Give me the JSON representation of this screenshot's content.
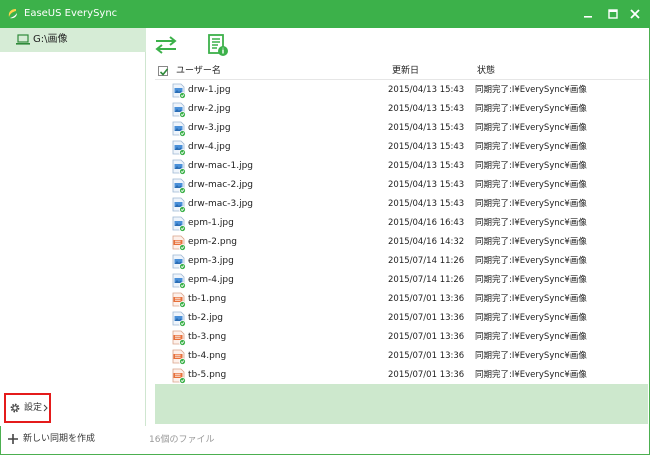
{
  "app": {
    "title": "EaseUS EverySync"
  },
  "sidebar": {
    "active_item": "G:\\画像",
    "settings_label": "設定",
    "new_sync_label": "新しい同期を作成"
  },
  "icons": {
    "logo": "easeus-logo-icon",
    "sync": "sync-arrows-icon",
    "report": "report-info-icon"
  },
  "colors": {
    "accent": "#3cb14a",
    "sidebar_active": "#d6ecd6",
    "highlight_box": "#e41b1b"
  },
  "table": {
    "headers": {
      "name": "ユーザー名",
      "date": "更新日",
      "status": "状態"
    },
    "rows": [
      {
        "name": "drw-1.jpg",
        "date": "2015/04/13 15:43",
        "status": "同期完了:I¥EverySync¥画像",
        "type": "jpg"
      },
      {
        "name": "drw-2.jpg",
        "date": "2015/04/13 15:43",
        "status": "同期完了:I¥EverySync¥画像",
        "type": "jpg"
      },
      {
        "name": "drw-3.jpg",
        "date": "2015/04/13 15:43",
        "status": "同期完了:I¥EverySync¥画像",
        "type": "jpg"
      },
      {
        "name": "drw-4.jpg",
        "date": "2015/04/13 15:43",
        "status": "同期完了:I¥EverySync¥画像",
        "type": "jpg"
      },
      {
        "name": "drw-mac-1.jpg",
        "date": "2015/04/13 15:43",
        "status": "同期完了:I¥EverySync¥画像",
        "type": "jpg"
      },
      {
        "name": "drw-mac-2.jpg",
        "date": "2015/04/13 15:43",
        "status": "同期完了:I¥EverySync¥画像",
        "type": "jpg"
      },
      {
        "name": "drw-mac-3.jpg",
        "date": "2015/04/13 15:43",
        "status": "同期完了:I¥EverySync¥画像",
        "type": "jpg"
      },
      {
        "name": "epm-1.jpg",
        "date": "2015/04/16 16:43",
        "status": "同期完了:I¥EverySync¥画像",
        "type": "jpg"
      },
      {
        "name": "epm-2.png",
        "date": "2015/04/16 14:32",
        "status": "同期完了:I¥EverySync¥画像",
        "type": "png"
      },
      {
        "name": "epm-3.jpg",
        "date": "2015/07/14 11:26",
        "status": "同期完了:I¥EverySync¥画像",
        "type": "jpg"
      },
      {
        "name": "epm-4.jpg",
        "date": "2015/07/14 11:26",
        "status": "同期完了:I¥EverySync¥画像",
        "type": "jpg"
      },
      {
        "name": "tb-1.png",
        "date": "2015/07/01 13:36",
        "status": "同期完了:I¥EverySync¥画像",
        "type": "png"
      },
      {
        "name": "tb-2.jpg",
        "date": "2015/07/01 13:36",
        "status": "同期完了:I¥EverySync¥画像",
        "type": "jpg"
      },
      {
        "name": "tb-3.png",
        "date": "2015/07/01 13:36",
        "status": "同期完了:I¥EverySync¥画像",
        "type": "png"
      },
      {
        "name": "tb-4.png",
        "date": "2015/07/01 13:36",
        "status": "同期完了:I¥EverySync¥画像",
        "type": "png"
      },
      {
        "name": "tb-5.png",
        "date": "2015/07/01 13:36",
        "status": "同期完了:I¥EverySync¥画像",
        "type": "png"
      }
    ]
  },
  "statusbar": {
    "file_count": "16個のファイル"
  }
}
